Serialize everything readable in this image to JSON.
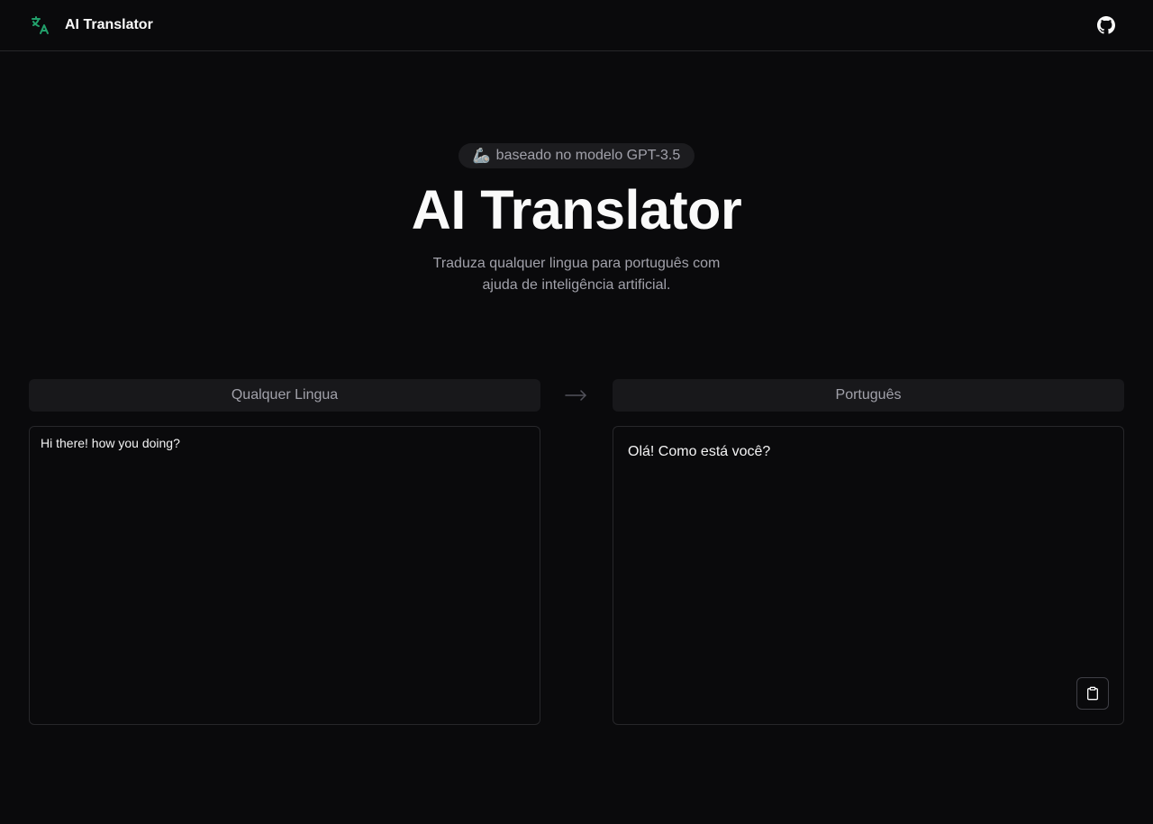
{
  "header": {
    "title": "AI Translator",
    "logo_icon": "translate-icon",
    "github_icon": "github-icon"
  },
  "hero": {
    "badge_emoji": "🦾",
    "badge_text": "baseado no modelo GPT-3.5",
    "title": "AI Translator",
    "subtitle": "Traduza qualquer lingua para português com ajuda de inteligência artificial."
  },
  "translator": {
    "source_language": "Qualquer Lingua",
    "target_language": "Português",
    "arrow_icon": "arrow-right-icon",
    "input_value": "Hi there! how you doing?",
    "output_value": "Olá! Como está você?",
    "copy_icon": "clipboard-icon"
  },
  "colors": {
    "background": "#0a0a0c",
    "accent": "#22a06b",
    "muted_text": "#a1a1aa",
    "border": "#27272a"
  }
}
